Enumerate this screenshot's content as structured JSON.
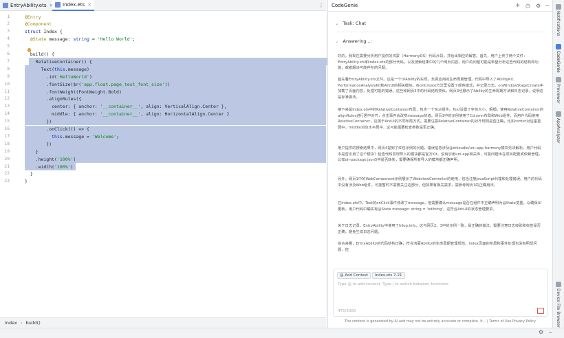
{
  "tabs": [
    {
      "label": "EntryAbility.ets",
      "close": "×"
    },
    {
      "label": "Index.ets",
      "close": "×"
    }
  ],
  "editor": {
    "line_numbers": [
      "1",
      "2",
      "3",
      "4",
      "5",
      "6",
      "7",
      "8",
      "9",
      "10",
      "11",
      "12",
      "13",
      "14",
      "15",
      "16",
      "17",
      "18",
      "19",
      "20",
      "21",
      "22",
      "23"
    ],
    "lines": [
      "@Entry",
      "@Component",
      "struct Index {",
      "  @State message: string = 'Hello World';",
      "",
      "  build() {",
      "    RelativeContainer() {",
      "      Text(this.message)",
      "        .id('HelloWorld')",
      "        .fontSize($r('app.float.page_text_font_size'))",
      "        .fontWeight(FontWeight.Bold)",
      "        .alignRules({",
      "          center: { anchor: '__container__', align: VerticalAlign.Center },",
      "          middle: { anchor: '__container__', align: HorizontalAlign.Center }",
      "        })",
      "        .onClick(() => {",
      "          this.message = 'Welcome';",
      "        })",
      "    }",
      "    .height('100%')",
      "    .width('100%')",
      "  }",
      "}"
    ]
  },
  "statusbar": {
    "path1": "Index",
    "sep": "›",
    "path2": "build()"
  },
  "panel": {
    "title": "CodeGenie",
    "task_label": "Task: Chat",
    "answering": "Answering...:",
    "paragraphs": [
      "好的，我现在需要分析用户提供的鸿蒙（HarmonyOS）代码片段，并给出相应的解答。首先，用户上传了两个文件：EntryAbility.ets和Index.ets的部分代码，以及搜索结果中的几个网页内容。用户的问题可能是希望分析这些代码的结构和功能，或者解决可能存在的问题。",
      "首先看EntryAbility.ets文件。这是一个UIAbility的实现，负责应用的生命周期管理。代码中导入了AbilityKit、PerformanceAnalysisKit和ArkUI的相关模块。在onCreate方法里设置了颜色模式，并记录日志。onWindowStageCreate中加载了页面内容，处理可能的错误。这些和网页3中的代码结构类似，网页3也展示了Ability的生命周期方法和日志记录，说明这是标准做法。",
      "接下来是Index.ets中的RelativeContainer布局，包含一个Text组件。Text设置了字体大小、粗细，使用RelativeContainer的alignRules进行居中对齐，点击事件会改变message的值。网页1中的示例使用了Column布局和Web组件，而用户代码使用RelativeContainer，这属于ArkUI的不同布局方式。需要注意RelativeContainer的对齐规则是否正确，比如center对应垂直居中，middle对应水平居中，这可能需要检查参数是否正确。",
      "用户提供的搜索结果中，网页4提到了红包示例的问题，错误信息涉及@dcloudio/uni-app-harmony模块无法解析。用户代码中是否引用了这个模块？检查代码发现导入的模块都是官方Kit，没有引用uni-app相关库，可能问题出在项目配置或依赖管理，比如oh-package.json5中是否缺失，需要确保所有导入的模块都正确声明。",
      "另外，网页1中的WebComponent示例展示了WebviewController的使用，包括注册JavaScript代理和处理错误。用户的代码中没有涉及Web组件，可能暂时不需要关注这部分，但如果有相关需求，需参考网页1的正确用法。",
      "在Index.ets中，Text的onClick事件修改了message，但需要确认message是否在组件中正确声明为@State变量，以确保UI更新。用户代码中确实有@State message: string = 'editting'，这符合ArkUI的状态管理要求。",
      "关于日志记录，EntryAbility中使用了hilog.info，这与网页2、3中的示例一致，是正确的做法。需要注意日志级别和标签是否正确，避免生成日志问题。",
      "综合来看，EntryAbility的代码结构正确，符合鸿蒙Ability的生命周期管理规范。Index页面的布局和事件处理也没有明显问题，但"
    ],
    "chips": {
      "add_context": "@ Add Context",
      "file_chip": "Index.ets 7-21"
    },
    "input_placeholder": "Type @ to add context. Type / to switch between functions.",
    "counter": "475/5000",
    "footer": "The content is generated by AI and may not be entirely accurate or complete. It...  |  Terms of Use   Privacy Policy"
  },
  "sidebar": {
    "items": [
      "Notifications",
      "CodeGenie",
      "Previewer",
      "AppAnalyzer",
      "Device File Browser"
    ]
  },
  "colors": {
    "selection": "#bcc8e3",
    "accent": "#4a7ee0",
    "keyword": "#0033b3",
    "string": "#067d17"
  }
}
